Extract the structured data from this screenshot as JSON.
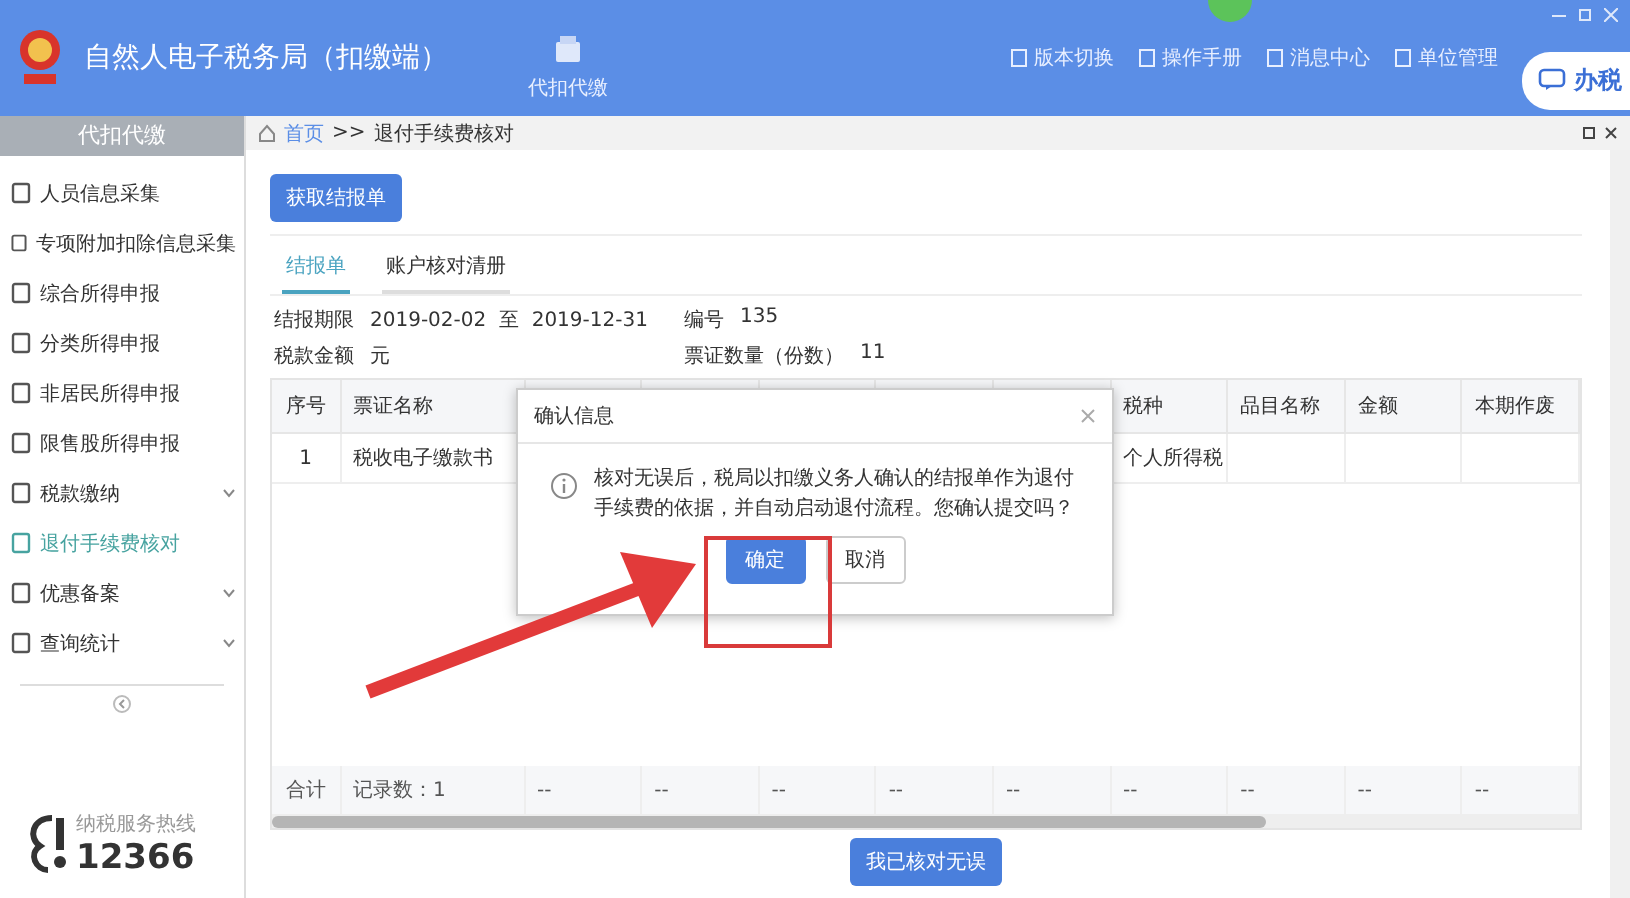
{
  "window": {
    "title": "自然人电子税务局（扣缴端）"
  },
  "toolbar": [
    {
      "label": "代扣代缴"
    }
  ],
  "header_links": [
    {
      "label": "版本切换"
    },
    {
      "label": "操作手册"
    },
    {
      "label": "消息中心"
    },
    {
      "label": "单位管理"
    }
  ],
  "header_tab": {
    "label": "办税"
  },
  "sidebar": {
    "title": "代扣代缴",
    "items": [
      {
        "label": "人员信息采集",
        "selected": false,
        "expandable": false
      },
      {
        "label": "专项附加扣除信息采集",
        "selected": false,
        "expandable": false
      },
      {
        "label": "综合所得申报",
        "selected": false,
        "expandable": false
      },
      {
        "label": "分类所得申报",
        "selected": false,
        "expandable": false
      },
      {
        "label": "非居民所得申报",
        "selected": false,
        "expandable": false
      },
      {
        "label": "限售股所得申报",
        "selected": false,
        "expandable": false
      },
      {
        "label": "税款缴纳",
        "selected": false,
        "expandable": true
      },
      {
        "label": "退付手续费核对",
        "selected": true,
        "expandable": false
      },
      {
        "label": "优惠备案",
        "selected": false,
        "expandable": true
      },
      {
        "label": "查询统计",
        "selected": false,
        "expandable": true
      }
    ],
    "hotline": {
      "label": "纳税服务热线",
      "number": "12366"
    }
  },
  "breadcrumb": [
    "首页",
    ">>",
    "退付手续费核对"
  ],
  "fetch_button": "获取结报单",
  "tabs": [
    {
      "label": "结报单",
      "selected": true
    },
    {
      "label": "账户核对清册",
      "selected": false
    }
  ],
  "fields": [
    {
      "label": "结报期限",
      "value": "2019-02-02  至  2019-12-31"
    },
    {
      "label": "编号",
      "value": "135"
    },
    {
      "label": "税款金额",
      "value": "元"
    },
    {
      "label": "票证数量（份数）",
      "value": "11"
    }
  ],
  "table": {
    "columns": [
      {
        "label": "序号"
      },
      {
        "label": "票证名称"
      },
      {},
      {},
      {},
      {},
      {},
      {
        "label": "税种"
      },
      {
        "label": "品目名称"
      },
      {
        "label": "金额"
      },
      {
        "label": "本期作废"
      }
    ],
    "rows": [
      {
        "cells": [
          "1",
          "税收电子缴款书",
          null,
          null,
          null,
          null,
          null,
          "个人所得税",
          null,
          null,
          null
        ]
      }
    ],
    "footer": [
      "合计",
      "记录数：1",
      "--",
      "--",
      "--",
      "--",
      "--",
      "--",
      "--",
      "--",
      "--"
    ]
  },
  "confirm_button": "我已核对无误",
  "dialog": {
    "title": "确认信息",
    "message": "核对无误后，税局以扣缴义务人确认的结报单作为退付手续费的依据，并自动启动退付流程。您确认提交吗？",
    "buttons": [
      {
        "label": "确定",
        "kind": "primary"
      },
      {
        "label": "取消",
        "kind": "secondary"
      }
    ]
  }
}
